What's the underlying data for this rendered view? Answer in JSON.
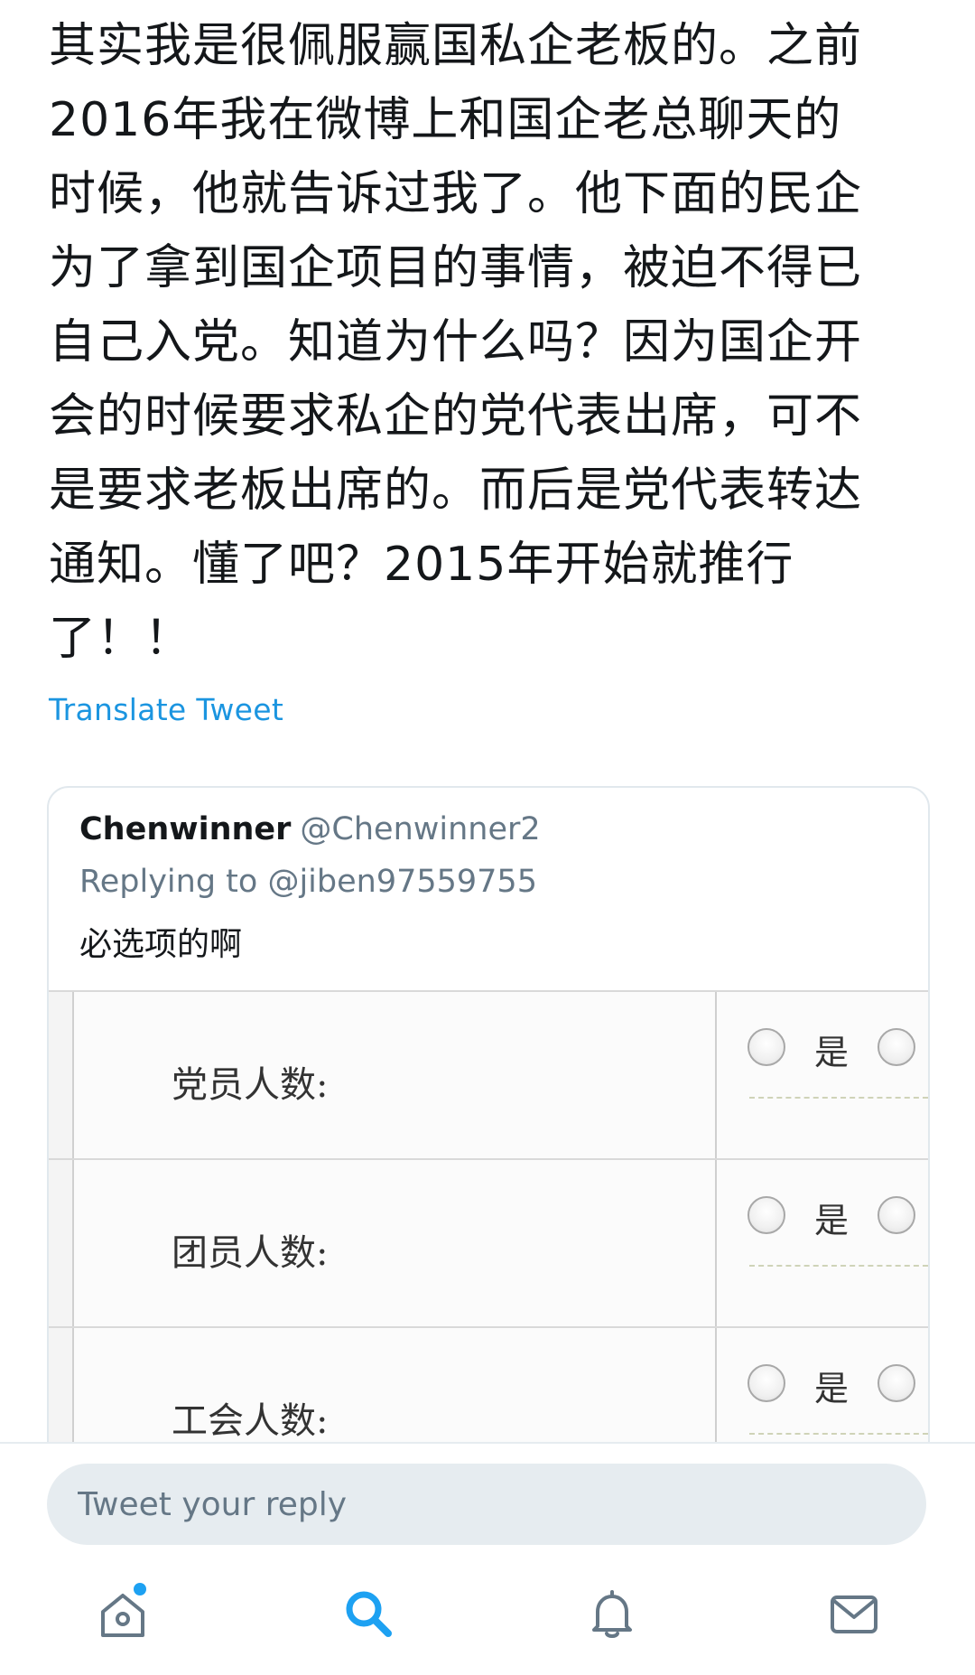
{
  "tweet": {
    "lines": [
      "其实我是很佩服赢国私企老板的。之前",
      "2016年我在微博上和国企老总聊天的",
      "时候，他就告诉过我了。他下面的民企",
      "为了拿到国企项目的事情，被迫不得已",
      "自己入党。知道为什么吗？因为国企开",
      "会的时候要求私企的党代表出席，可不",
      "是要求老板出席的。而后是党代表转达",
      "通知。懂了吧？2015年开始就推行",
      "了！！"
    ],
    "translate_label": "Translate Tweet"
  },
  "quote": {
    "name": "Chenwinner",
    "handle": "@Chenwinner2",
    "replying": "Replying to @jiben97559755",
    "text": "必选项的啊",
    "form_rows": [
      {
        "label": "党员人数:",
        "option": "是"
      },
      {
        "label": "团员人数:",
        "option": "是"
      },
      {
        "label": "工会人数:",
        "option": "是"
      }
    ]
  },
  "reply": {
    "placeholder": "Tweet your reply"
  },
  "tabbar": {
    "items": [
      {
        "icon": "home-icon",
        "has_notification_dot": true
      },
      {
        "icon": "search-icon",
        "active": true
      },
      {
        "icon": "bell-icon"
      },
      {
        "icon": "mail-icon"
      }
    ],
    "accent_color": "#1da1f2",
    "inactive_color": "#657786"
  }
}
